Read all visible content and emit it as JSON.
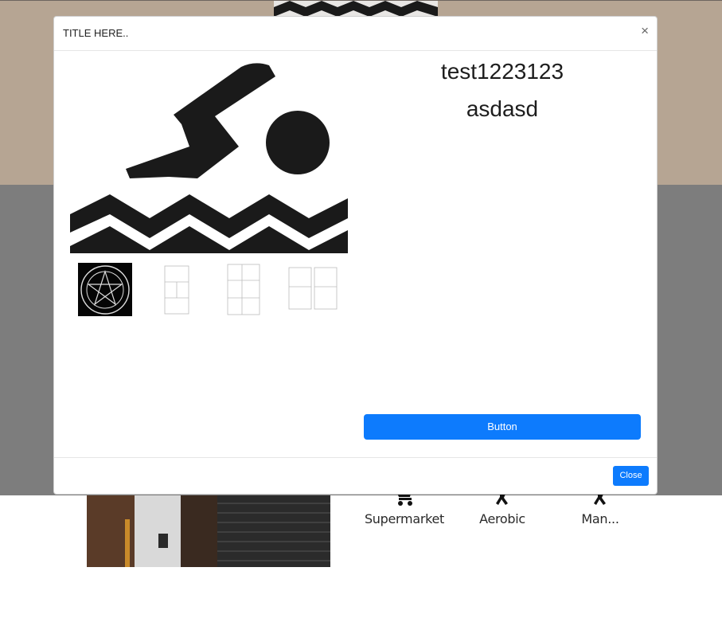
{
  "modal": {
    "title": "TITLE HERE..",
    "close_x": "×",
    "heading_1": "test1223123",
    "heading_2": "asdasd",
    "button_label": "Button",
    "close_label": "Close"
  },
  "amenities": [
    {
      "label": "Supermarket",
      "icon": "cart-icon"
    },
    {
      "label": "Aerobic",
      "icon": "runner-icon"
    },
    {
      "label": "Man...",
      "icon": "runner-icon"
    }
  ],
  "colors": {
    "primary": "#0d7bfd",
    "hero": "#b6a593",
    "backdrop": "#7d7d7d"
  }
}
